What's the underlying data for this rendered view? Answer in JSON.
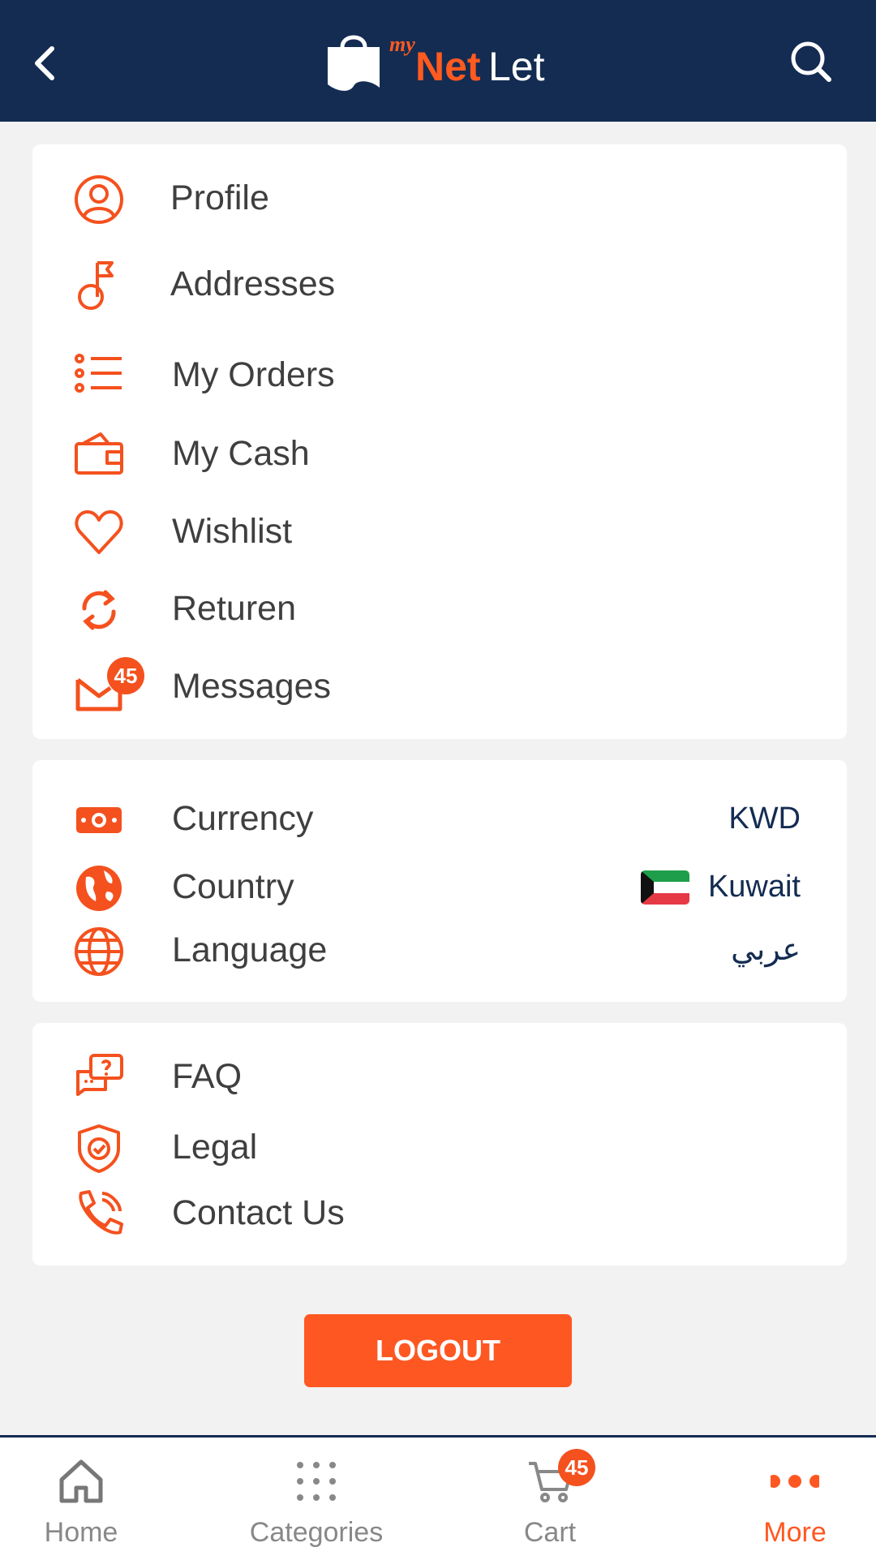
{
  "header": {
    "logo_my": "my",
    "logo_net": "Net",
    "logo_let": "Let",
    "back_icon": "chevron-left-icon",
    "search_icon": "search-icon"
  },
  "account_menu": [
    {
      "label": "Profile",
      "icon": "user-icon"
    },
    {
      "label": "Addresses",
      "icon": "flag-pin-icon"
    },
    {
      "label": "My Orders",
      "icon": "list-icon"
    },
    {
      "label": "My Cash",
      "icon": "wallet-icon"
    },
    {
      "label": "Wishlist",
      "icon": "heart-icon"
    },
    {
      "label": "Returen",
      "icon": "refresh-icon"
    },
    {
      "label": "Messages",
      "icon": "mail-icon",
      "badge": "45"
    }
  ],
  "settings": {
    "currency": {
      "label": "Currency",
      "value": "KWD",
      "icon": "money-icon"
    },
    "country": {
      "label": "Country",
      "value": "Kuwait",
      "icon": "earth-icon",
      "flag": "kuwait-flag"
    },
    "language": {
      "label": "Language",
      "value": "عربي",
      "icon": "globe-icon"
    }
  },
  "support_menu": [
    {
      "label": "FAQ",
      "icon": "chat-question-icon"
    },
    {
      "label": "Legal",
      "icon": "shield-check-icon"
    },
    {
      "label": "Contact Us",
      "icon": "phone-icon"
    }
  ],
  "logout_label": "LOGOUT",
  "tabbar": {
    "items": [
      {
        "label": "Home",
        "icon": "home-icon"
      },
      {
        "label": "Categories",
        "icon": "grid-dots-icon"
      },
      {
        "label": "Cart",
        "icon": "cart-icon",
        "badge": "45"
      },
      {
        "label": "More",
        "icon": "more-dots-icon",
        "active": true
      }
    ]
  },
  "colors": {
    "header_bg": "#142c52",
    "accent": "#ff5722",
    "page_bg": "#f2f2f2"
  }
}
